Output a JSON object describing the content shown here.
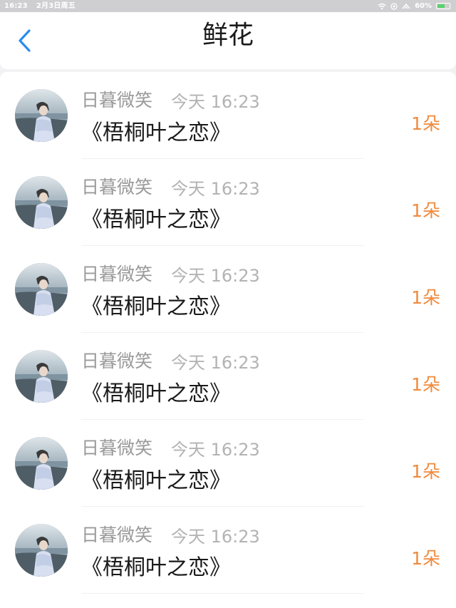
{
  "status_bar": {
    "time": "16:23",
    "date": "2月3日周五",
    "battery": "60%",
    "battery_level": 0.6
  },
  "header": {
    "title": "鲜花",
    "back_icon": "chevron-left-icon"
  },
  "colors": {
    "accent": "#2a8cf0",
    "count": "#f08a3c",
    "battery": "#58d36a"
  },
  "list": {
    "items": [
      {
        "user": "日暮微笑",
        "time": "今天 16:23",
        "gift": "《梧桐叶之恋》",
        "count": "1朵"
      },
      {
        "user": "日暮微笑",
        "time": "今天 16:23",
        "gift": "《梧桐叶之恋》",
        "count": "1朵"
      },
      {
        "user": "日暮微笑",
        "time": "今天 16:23",
        "gift": "《梧桐叶之恋》",
        "count": "1朵"
      },
      {
        "user": "日暮微笑",
        "time": "今天 16:23",
        "gift": "《梧桐叶之恋》",
        "count": "1朵"
      },
      {
        "user": "日暮微笑",
        "time": "今天 16:23",
        "gift": "《梧桐叶之恋》",
        "count": "1朵"
      },
      {
        "user": "日暮微笑",
        "time": "今天 16:23",
        "gift": "《梧桐叶之恋》",
        "count": "1朵"
      }
    ]
  }
}
